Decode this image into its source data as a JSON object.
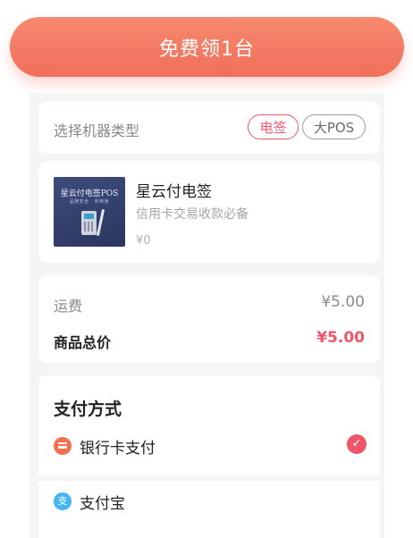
{
  "cta": {
    "label": "免费领1台"
  },
  "machine_type": {
    "label": "选择机器类型",
    "options": [
      {
        "label": "电签",
        "selected": true
      },
      {
        "label": "大POS",
        "selected": false
      }
    ]
  },
  "product": {
    "image_title": "星云付电签POS",
    "image_subtitle": "品牌安全 · 秒到账",
    "name": "星云付电签",
    "description": "信用卡交易收款必备",
    "price": "¥0"
  },
  "summary": {
    "shipping_label": "运费",
    "shipping_value": "¥5.00",
    "total_label": "商品总价",
    "total_value": "¥5.00"
  },
  "payment": {
    "title": "支付方式",
    "methods": [
      {
        "label": "银行卡支付",
        "icon": "bank-card-icon",
        "selected": true
      },
      {
        "label": "支付宝",
        "icon": "alipay-icon",
        "selected": false
      }
    ]
  },
  "colors": {
    "accent": "#f0566a",
    "cta_gradient_top": "#f6896f",
    "cta_gradient_bottom": "#f16f5a",
    "alipay_blue": "#45b6f3"
  }
}
